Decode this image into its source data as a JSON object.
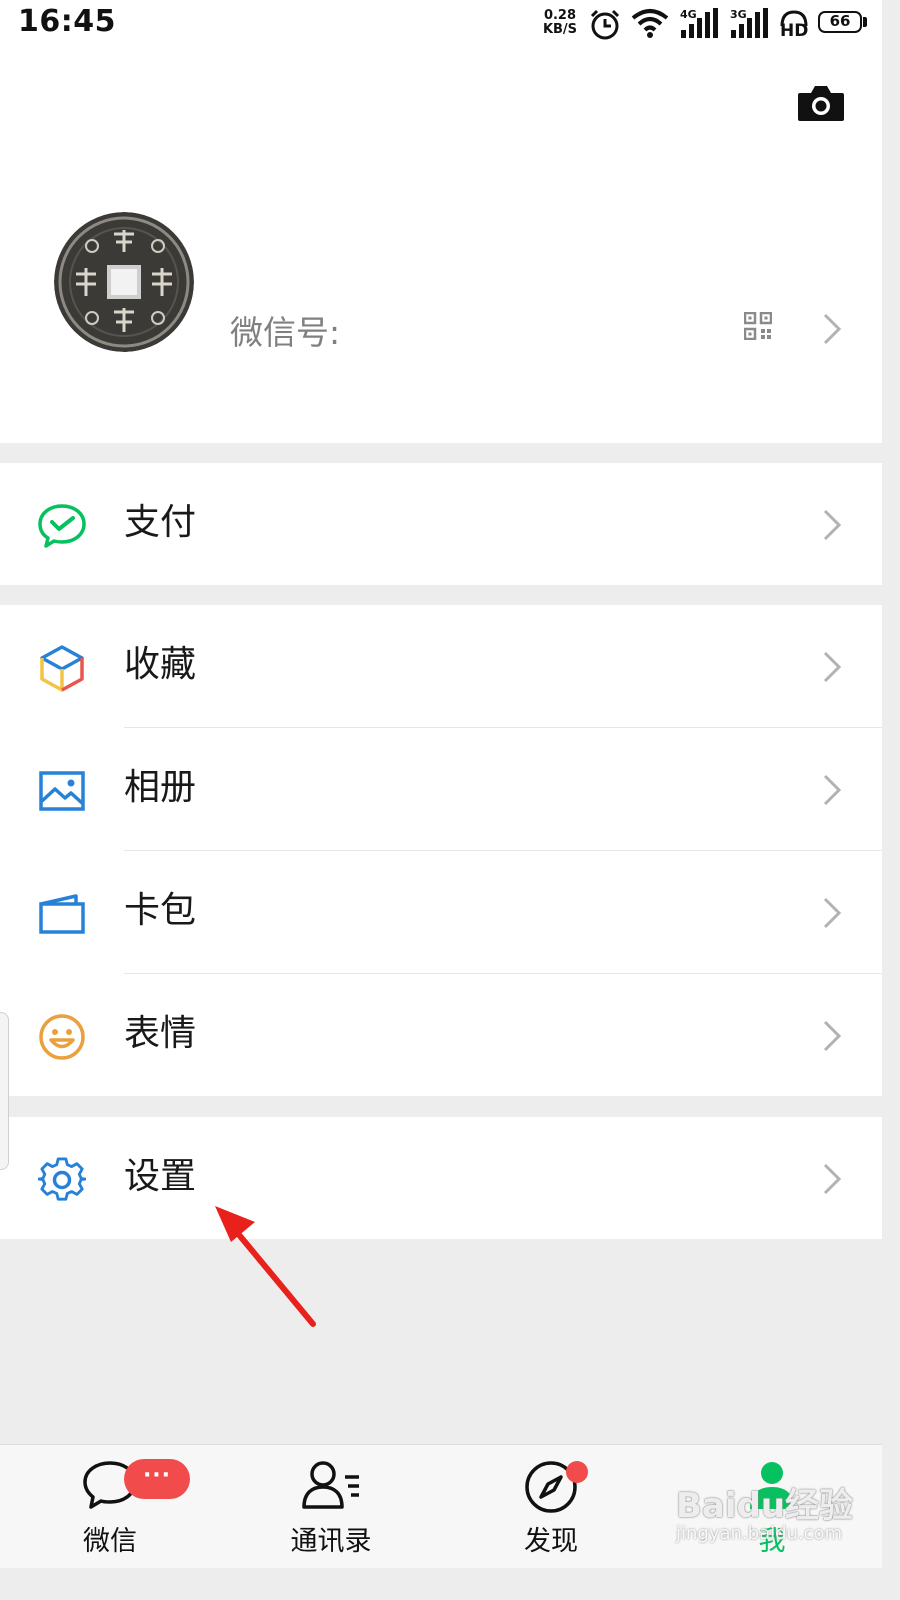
{
  "status_bar": {
    "time": "16:45",
    "net_speed_value": "0.28",
    "net_speed_unit": "KB/S",
    "signal_1_type": "4G",
    "signal_2_type": "3G",
    "hd_label": "HD",
    "battery": "66",
    "icons": [
      "alarm-icon",
      "wifi-icon",
      "signal-4g-icon",
      "signal-3g-icon",
      "hd-icon",
      "battery-icon"
    ]
  },
  "profile": {
    "wechat_id_label": "微信号:",
    "avatar_icon": "coin-avatar",
    "camera_icon": "camera-icon",
    "qr_icon": "qr-code-icon"
  },
  "menu": {
    "pay": {
      "label": "支付",
      "icon": "pay-icon",
      "color": "#07c160"
    },
    "favorites": {
      "label": "收藏",
      "icon": "cube-icon"
    },
    "album": {
      "label": "相册",
      "icon": "photo-icon",
      "color": "#2782d7"
    },
    "cards": {
      "label": "卡包",
      "icon": "wallet-icon",
      "color": "#2782d7"
    },
    "stickers": {
      "label": "表情",
      "icon": "smile-icon",
      "color": "#e9a03d"
    },
    "settings": {
      "label": "设置",
      "icon": "gear-icon",
      "color": "#2782d7"
    }
  },
  "annotation": {
    "arrow_color": "#e8211c",
    "points_to": "settings"
  },
  "tabbar": {
    "tabs": [
      {
        "label": "微信",
        "icon": "chat-bubble-icon",
        "badge": "···"
      },
      {
        "label": "通讯录",
        "icon": "contacts-icon"
      },
      {
        "label": "发现",
        "icon": "compass-icon",
        "dot": true
      },
      {
        "label": "我",
        "icon": "person-icon",
        "active": true,
        "color": "#07c160"
      }
    ]
  },
  "watermark": {
    "text": "Baidu经验",
    "url": "jingyan.baidu.com"
  }
}
